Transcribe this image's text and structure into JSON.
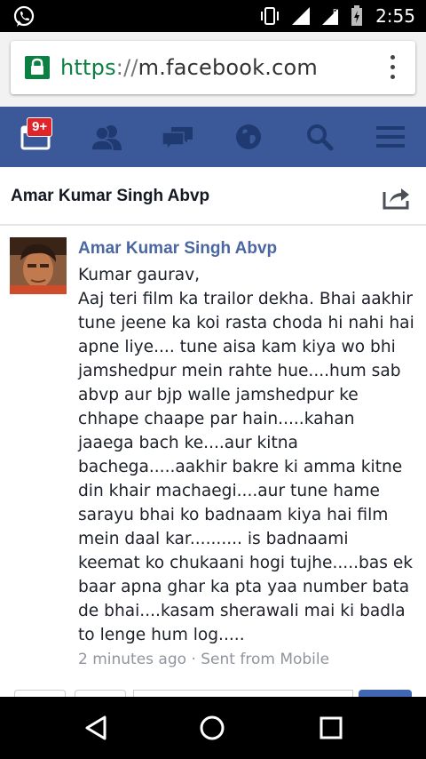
{
  "status_bar": {
    "time": "2:55",
    "icons": [
      "whatsapp-icon",
      "vibrate-icon",
      "signal-icon",
      "roaming-icon",
      "battery-charging-icon"
    ]
  },
  "browser": {
    "url_scheme": "https",
    "url_separator": "://",
    "url_host": "m.facebook.com",
    "secure": true
  },
  "fb_nav": {
    "notification_badge": "9+",
    "items": [
      "notifications-icon",
      "friends-icon",
      "messages-icon",
      "globe-icon",
      "search-icon",
      "menu-icon"
    ],
    "color": "#3b5998"
  },
  "header": {
    "title": "Amar Kumar Singh Abvp"
  },
  "post": {
    "author": "Amar Kumar Singh Abvp",
    "body": "Kumar gaurav,\nAaj teri film ka trailor dekha. Bhai aakhir tune jeene ka koi rasta choda hi nahi hai apne liye.... tune aisa kam kiya wo bhi jamshedpur mein rahte hue....hum sab abvp aur bjp walle jamshedpur ke chhape chaape par hain.....kahan jaaega bach ke....aur kitna bachega.....aakhir bakre ki amma kitne din khair machaegi....aur tune hame sarayu bhai ko badnaam kiya hai film mein daal kar.......... is badnaami keemat ko chukaani hogi tujhe.....bas ek baar apna ghar ka pta yaa number bata de bhai....kasam sherawali mai ki badla to lenge hum log.....",
    "meta": "2 minutes ago · Sent from Mobile"
  }
}
